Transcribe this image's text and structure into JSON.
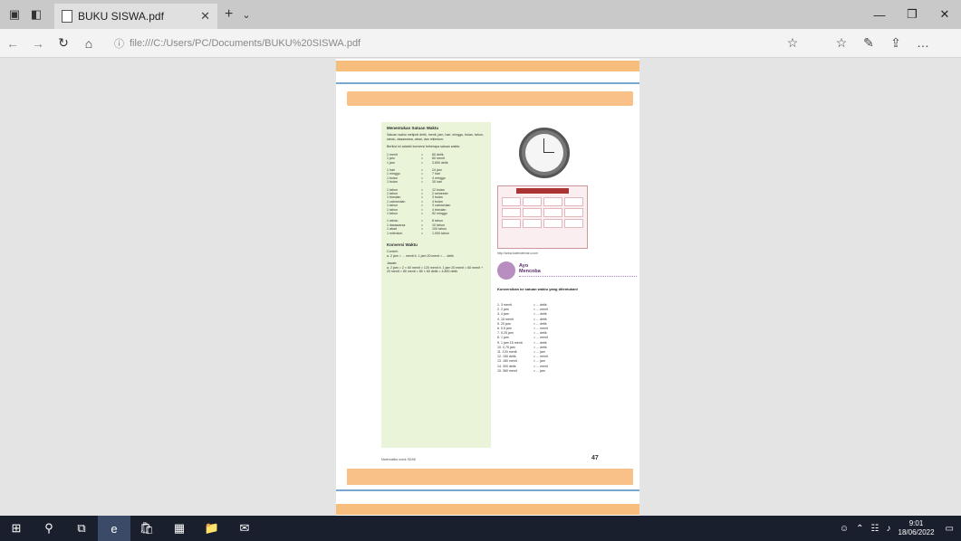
{
  "tab": {
    "title": "BUKU SISWA.pdf"
  },
  "address": {
    "url": "file:///C:/Users/PC/Documents/BUKU%20SISWA.pdf"
  },
  "page": {
    "left_title": "Menentukan Satuan Waktu",
    "left_intro": "Satuan waktu meliputi detik, menit, jam, hari, minggu, bulan, tahun, windu, dasawarsa, abad, dan milenium.",
    "left_sub": "Berikut ini adalah konversi beberapa satuan waktu:",
    "conversions": [
      [
        "1 menit",
        "=",
        "60 detik"
      ],
      [
        "1 jam",
        "=",
        "60 menit"
      ],
      [
        "1 jam",
        "=",
        "3.600 detik"
      ],
      [
        "",
        "",
        ""
      ],
      [
        "1 hari",
        "=",
        "24 jam"
      ],
      [
        "1 minggu",
        "=",
        "7 hari"
      ],
      [
        "1 bulan",
        "=",
        "4 minggu"
      ],
      [
        "1 bulan",
        "=",
        "30 hari"
      ],
      [
        "",
        "",
        ""
      ],
      [
        "1 tahun",
        "=",
        "12 bulan"
      ],
      [
        "1 tahun",
        "=",
        "2 semester"
      ],
      [
        "1 triwulan",
        "=",
        "3 bulan"
      ],
      [
        "1 caturwulan",
        "=",
        "4 bulan"
      ],
      [
        "1 tahun",
        "=",
        "3 caturwulan"
      ],
      [
        "1 tahun",
        "=",
        "4 triwulan"
      ],
      [
        "1 tahun",
        "=",
        "52 minggu"
      ],
      [
        "",
        "",
        ""
      ],
      [
        "1 windu",
        "=",
        "8 tahun"
      ],
      [
        "1 dasawarsa",
        "=",
        "10 tahun"
      ],
      [
        "1 abad",
        "=",
        "100 tahun"
      ],
      [
        "1 milenium",
        "=",
        "1.000 tahun"
      ]
    ],
    "left_title2": "Konversi Waktu",
    "left_contoh_label": "Contoh:",
    "left_contoh": "a. 2 jam = ... menit   b. 1 jam 20 menit = ... detik",
    "left_jawab_label": "Jawab:",
    "left_jawab": "a. 2 jam = 2 × 60 menit = 120 menit   b. 1 jam 20 menit = 60 menit + 20 menit = 80 menit = 80 × 60 detik = 4.800 detik",
    "cal_caption": "http://www.kalenderbaru.com",
    "ayo_title_1": "Ayo",
    "ayo_title_2": "Mencoba",
    "soal_title": "Konversikan ke satuan waktu yang ditentukan!",
    "questions": [
      [
        "1. 3 menit",
        "= ... detik"
      ],
      [
        "2. 2 jam",
        "= ... menit"
      ],
      [
        "3. 4 jam",
        "= ... detik"
      ],
      [
        "4. 15 menit",
        "= ... detik"
      ],
      [
        "5. 20 jam",
        "= ... detik"
      ],
      [
        "6. 0,5 jam",
        "= ... menit"
      ],
      [
        "7. 0,25 jam",
        "= ... detik"
      ],
      [
        "8. 1 jam",
        "= ... menit"
      ],
      [
        "9. 1 jam 15 menit",
        "= ... detik"
      ],
      [
        "10. 0,75 jam",
        "= ... detik"
      ],
      [
        "11. 120 menit",
        "= ... jam"
      ],
      [
        "12. 150 detik",
        "= ... menit"
      ],
      [
        "13. 180 menit",
        "= ... jam"
      ],
      [
        "14. 300 detik",
        "= ... menit"
      ],
      [
        "15. 360 menit",
        "= ... jam"
      ]
    ],
    "footer_left": "Matematika untuk SD/MI",
    "page_number": "47"
  },
  "taskbar": {
    "time": "9:01",
    "date": "18/06/2022"
  }
}
